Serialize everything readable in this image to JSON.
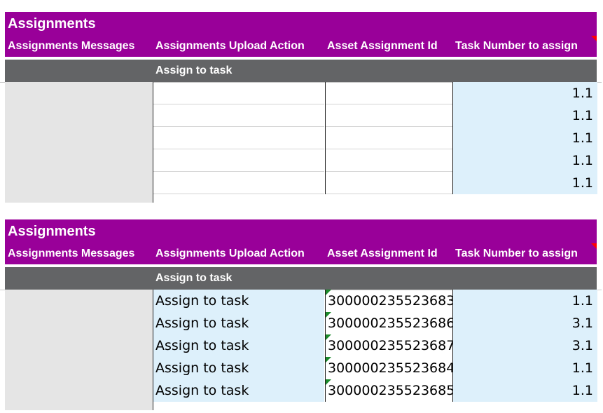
{
  "sections": [
    {
      "title": "Assignments",
      "headers": [
        "Assignments Messages",
        "Assignments Upload Action",
        "Asset Assignment Id",
        "Task Number to assign"
      ],
      "action_label": "Assign to task",
      "rows": [
        {
          "message": "",
          "action": "",
          "asset_id": "",
          "task": "1.1"
        },
        {
          "message": "",
          "action": "",
          "asset_id": "",
          "task": "1.1"
        },
        {
          "message": "",
          "action": "",
          "asset_id": "",
          "task": "1.1"
        },
        {
          "message": "",
          "action": "",
          "asset_id": "",
          "task": "1.1"
        },
        {
          "message": "",
          "action": "",
          "asset_id": "",
          "task": "1.1"
        }
      ]
    },
    {
      "title": "Assignments",
      "headers": [
        "Assignments Messages",
        "Assignments Upload Action",
        "Asset Assignment Id",
        "Task Number to assign"
      ],
      "action_label": "Assign to task",
      "rows": [
        {
          "message": "",
          "action": "Assign to task",
          "asset_id": "300000235523683",
          "task": "1.1"
        },
        {
          "message": "",
          "action": "Assign to task",
          "asset_id": "300000235523686",
          "task": "3.1"
        },
        {
          "message": "",
          "action": "Assign to task",
          "asset_id": "300000235523687",
          "task": "3.1"
        },
        {
          "message": "",
          "action": "Assign to task",
          "asset_id": "300000235523684",
          "task": "1.1"
        },
        {
          "message": "",
          "action": "Assign to task",
          "asset_id": "300000235523685",
          "task": "1.1"
        }
      ]
    }
  ],
  "colors": {
    "header": "#990099",
    "action_row": "#636466",
    "editable_cell": "#ddf0fb",
    "messages_col": "#e5e5e5",
    "comment_marker": "#ff0000",
    "number_as_text_marker": "#1a8a2a"
  }
}
